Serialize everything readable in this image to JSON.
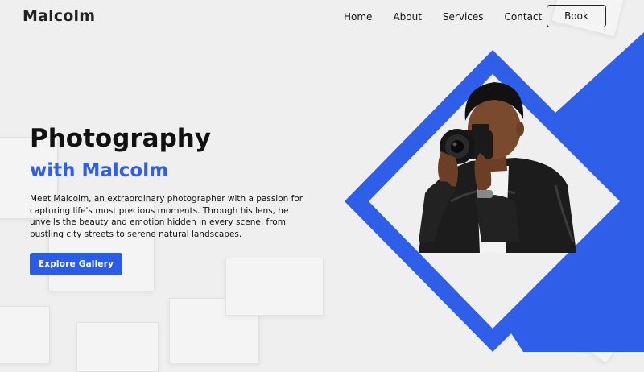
{
  "header": {
    "logo": "Malcolm",
    "nav": [
      "Home",
      "About",
      "Services",
      "Contact"
    ],
    "book_label": "Book"
  },
  "hero": {
    "title": "Photography",
    "subtitle": "with Malcolm",
    "description": "Meet Malcolm, an extraordinary photographer with a passion for capturing life's most precious moments. Through his lens, he unveils the beauty and emotion hidden in every scene, from bustling city streets to serene natural landscapes.",
    "cta_label": "Explore Gallery"
  },
  "colors": {
    "accent": "#2f5ee8",
    "background": "#efefef"
  }
}
